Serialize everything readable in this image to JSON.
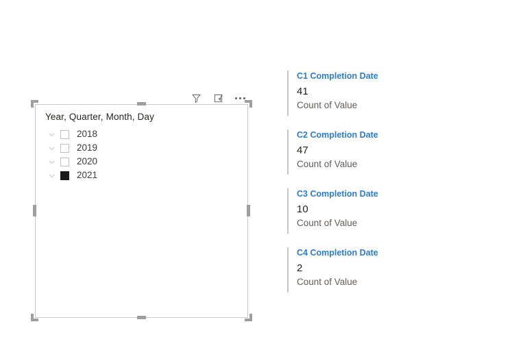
{
  "canvas": {
    "background": "#ffffff"
  },
  "slicer": {
    "header": "Year, Quarter, Month, Day",
    "toolbar": {
      "filter_icon": "filter-icon",
      "focus_icon": "focus-mode-icon",
      "more_icon": "more-options-icon",
      "filter_tooltip": "Filters",
      "focus_tooltip": "Focus mode",
      "more_tooltip": "More options"
    },
    "items": [
      {
        "label": "2018",
        "checked": false,
        "expanded": false
      },
      {
        "label": "2019",
        "checked": false,
        "expanded": false
      },
      {
        "label": "2020",
        "checked": false,
        "expanded": false
      },
      {
        "label": "2021",
        "checked": true,
        "expanded": false
      }
    ],
    "selected": true,
    "selection_handles": [
      "top-left",
      "top-center",
      "top-right",
      "middle-left",
      "middle-right",
      "bottom-left",
      "bottom-center",
      "bottom-right"
    ]
  },
  "cards": [
    {
      "title": "C1 Completion Date",
      "value": "41",
      "subtitle": "Count of Value"
    },
    {
      "title": "C2 Completion Date",
      "value": "47",
      "subtitle": "Count of Value"
    },
    {
      "title": "C3 Completion Date",
      "value": "10",
      "subtitle": "Count of Value"
    },
    {
      "title": "C4 Completion Date",
      "value": "2",
      "subtitle": "Count of Value"
    }
  ],
  "colors": {
    "card_title": "#2b7cd3",
    "card_value": "#252423",
    "card_subtitle": "#605e5c",
    "accent_bar": "#c7c7c7",
    "visual_border": "#c8c8c8",
    "handle": "#9e9e9e",
    "checkbox_checked": "#1a1a1a",
    "checkbox_border": "#bfbfbf"
  }
}
